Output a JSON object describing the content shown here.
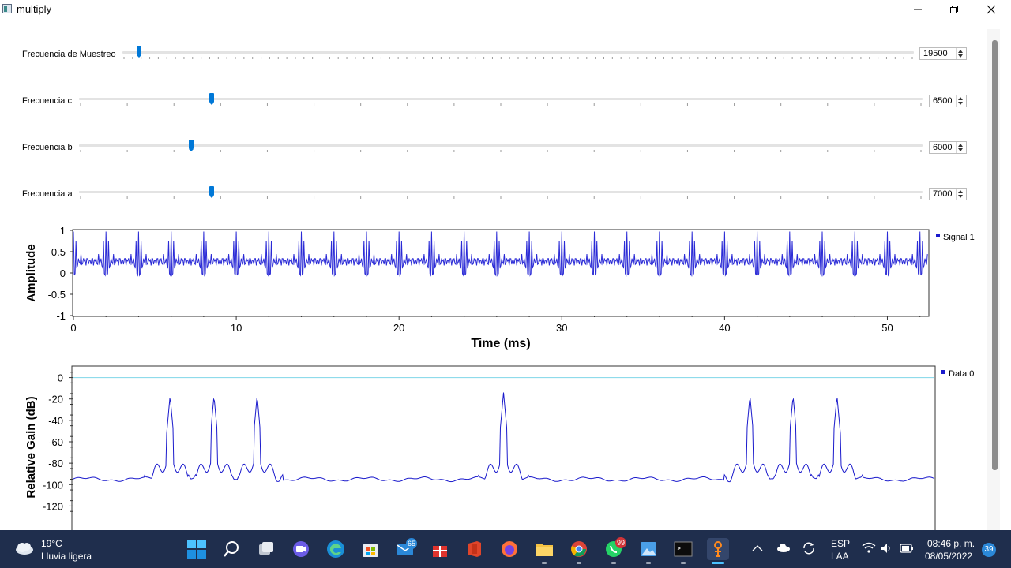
{
  "window": {
    "title": "multiply"
  },
  "sliders": [
    {
      "label": "Frecuencia de Muestreo",
      "value": "19500"
    },
    {
      "label": "Frecuencia c",
      "value": "6500"
    },
    {
      "label": "Frecuencia b",
      "value": "6000"
    },
    {
      "label": "Frecuencia a",
      "value": "7000"
    }
  ],
  "chart_data": [
    {
      "type": "line",
      "xlabel": "Time (ms)",
      "ylabel": "Amplitude",
      "xlim": [
        0,
        52.5
      ],
      "ylim": [
        -1,
        1
      ],
      "xticks": [
        "0",
        "10",
        "20",
        "30",
        "40",
        "50"
      ],
      "yticks": [
        "1",
        "0.5",
        "0",
        "-0.5",
        "-1"
      ],
      "series": [
        {
          "name": "Signal 1",
          "color": "#2a2ad6"
        }
      ],
      "x": [
        0,
        0.26,
        0.51,
        0.77,
        1.03,
        1.28,
        1.54,
        1.79,
        2.05
      ],
      "y": [
        0.27,
        0.9,
        0.45,
        -0.05,
        0.62,
        0.3,
        0.02,
        0.72,
        0.27
      ],
      "legend": "right",
      "grid": false
    },
    {
      "type": "line",
      "xlabel": "",
      "ylabel": "Relative Gain (dB)",
      "ylim": [
        -130,
        10
      ],
      "yticks": [
        "0",
        "-20",
        "-40",
        "-60",
        "-80",
        "-100",
        "-120"
      ],
      "series": [
        {
          "name": "Data 0",
          "color": "#1a1acc"
        }
      ],
      "reference_line": {
        "value": 0,
        "color": "#7fd6e8"
      },
      "x": [
        0,
        0.113,
        0.164,
        0.214,
        0.5,
        0.786,
        0.836,
        0.887,
        1
      ],
      "y": [
        -95,
        -17,
        -17,
        -17,
        -14,
        -17,
        -17,
        -17,
        -95
      ],
      "legend": "right",
      "grid": false
    }
  ],
  "taskbar": {
    "weather_temp": "19°C",
    "weather_desc": "Lluvia ligera",
    "mail_badge": "65",
    "whatsapp_badge": "99",
    "lang_top": "ESP",
    "lang_bottom": "LAA",
    "time": "08:46 p. m.",
    "date": "08/05/2022",
    "notif_count": "39",
    "apps": [
      "start-icon",
      "search-icon",
      "task-view-icon",
      "chat-icon",
      "edge-icon",
      "store-icon",
      "mail-icon",
      "gift-icon",
      "office-icon",
      "firefox-icon",
      "file-explorer-icon",
      "chrome-icon",
      "whatsapp-icon",
      "photos-icon",
      "terminal-icon",
      "gnuradio-icon"
    ]
  }
}
